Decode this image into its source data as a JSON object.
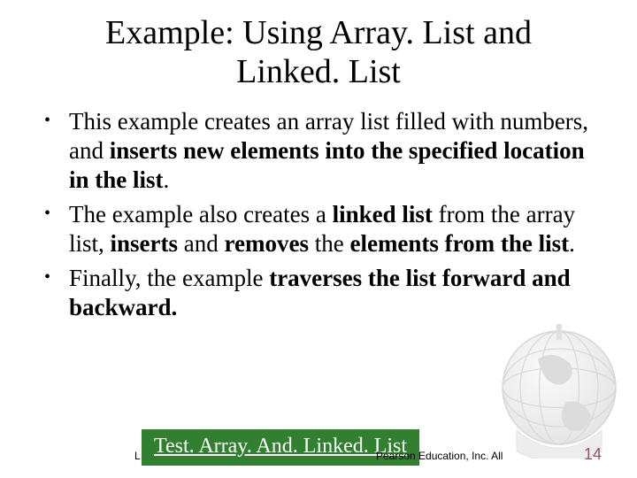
{
  "title_line1": "Example: Using Array. List and",
  "title_line2": "Linked. List",
  "bullets": {
    "b1": "This example creates an array list filled with numbers, and <b>inserts new elements into the specified location in the list</b>.",
    "b2": "The example also creates a <b>linked list</b> from the array list, <b>inserts</b> and <b>removes</b> the <b>elements from the list</b>.",
    "b3": "Finally, the example <b>traverses the list forward and backward.</b>"
  },
  "button_label": "Test. Array. And. Linked. List",
  "footer_left_stub": "L",
  "footer_copy": "Pearson Education, Inc. All",
  "page_number": "14"
}
